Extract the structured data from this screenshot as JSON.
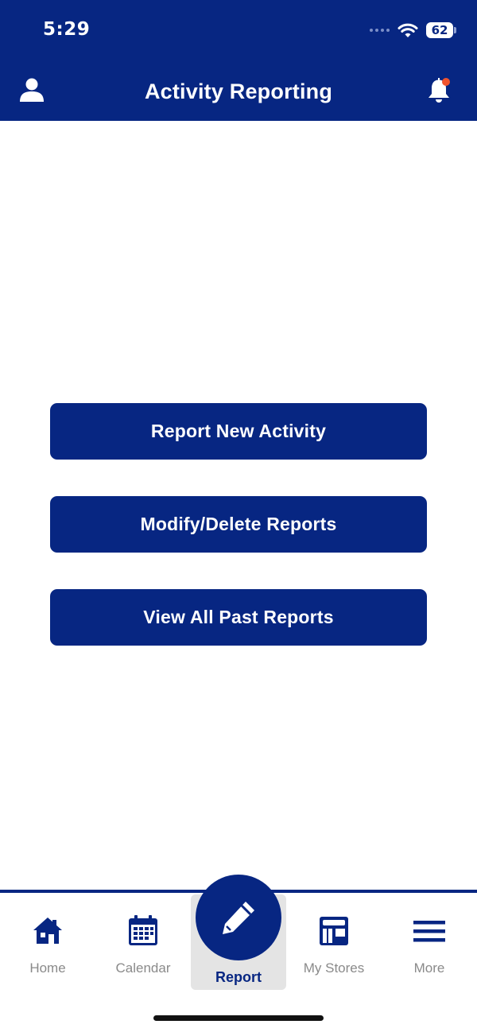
{
  "status_bar": {
    "time": "5:29",
    "battery": "62"
  },
  "header": {
    "title": "Activity Reporting",
    "profile_icon": "person-icon",
    "notifications_icon": "bell-icon",
    "notification_dot_color": "#f0542e"
  },
  "actions": [
    {
      "label": "Report New Activity"
    },
    {
      "label": "Modify/Delete Reports"
    },
    {
      "label": "View All Past Reports"
    }
  ],
  "tab_bar": {
    "tabs": [
      {
        "label": "Home",
        "icon": "house-icon"
      },
      {
        "label": "Calendar",
        "icon": "calendar-icon"
      },
      {
        "label": "Report",
        "icon": "pencil-icon",
        "selected": true
      },
      {
        "label": "My Stores",
        "icon": "store-icon"
      },
      {
        "label": "More",
        "icon": "menu-icon"
      }
    ]
  },
  "colors": {
    "brand": "#072682",
    "inactive_label": "#8a8a8a",
    "selected_tab_bg": "#e4e4e4"
  }
}
